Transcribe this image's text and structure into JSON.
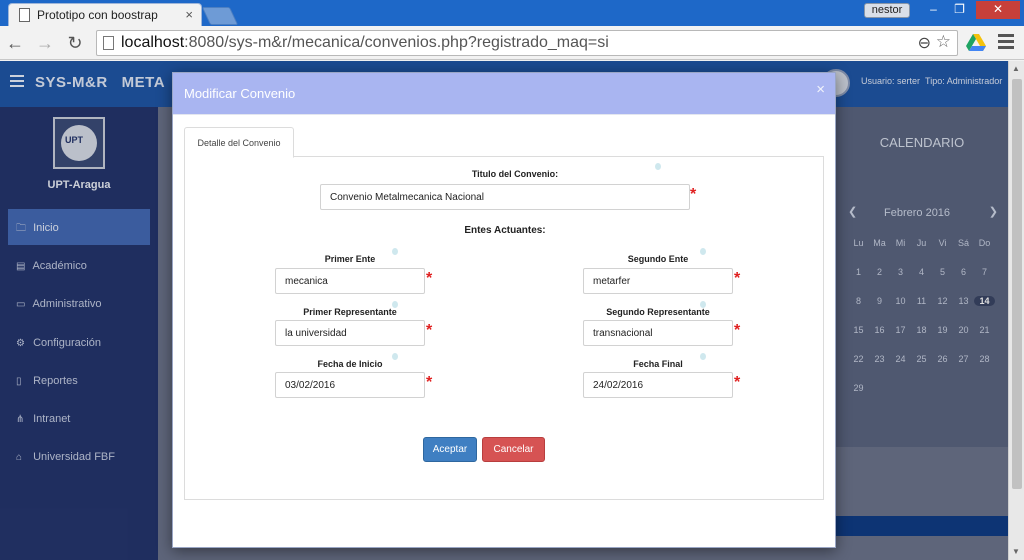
{
  "browser": {
    "tab_title": "Prototipo con boostrap",
    "tab_close": "×",
    "user_badge": "nestor",
    "url_host": "localhost",
    "url_path": ":8080/sys-m&r/mecanica/convenios.php?registrado_maq=si"
  },
  "app": {
    "brand": "SYS-M&R   META",
    "user_label": "Usuario: serter",
    "type_label": "Tipo: Administrador",
    "campus": "UPT-Aragua",
    "logo_text": "UPT"
  },
  "sidebar": {
    "items": [
      {
        "label": "Inicio",
        "icon": "folder-icon"
      },
      {
        "label": "Académico",
        "icon": "book-icon"
      },
      {
        "label": "Administrativo",
        "icon": "monitor-icon"
      },
      {
        "label": "Configuración",
        "icon": "cogs-icon"
      },
      {
        "label": "Reportes",
        "icon": "file-icon"
      },
      {
        "label": "Intranet",
        "icon": "sitemap-icon"
      },
      {
        "label": "Universidad FBF",
        "icon": "bank-icon"
      }
    ]
  },
  "calendar": {
    "title": "CALENDARIO",
    "month": "Febrero 2016",
    "weekdays": [
      "Lu",
      "Ma",
      "Mi",
      "Ju",
      "Vi",
      "Sá",
      "Do"
    ],
    "weeks": [
      [
        "1",
        "2",
        "3",
        "4",
        "5",
        "6",
        "7"
      ],
      [
        "8",
        "9",
        "10",
        "11",
        "12",
        "13",
        "14"
      ],
      [
        "15",
        "16",
        "17",
        "18",
        "19",
        "20",
        "21"
      ],
      [
        "22",
        "23",
        "24",
        "25",
        "26",
        "27",
        "28"
      ],
      [
        "29",
        "",
        "",
        "",
        "",
        "",
        ""
      ]
    ],
    "today": "14"
  },
  "modal": {
    "title": "Modificar Convenio",
    "close": "×",
    "tab_label": "Detalle del Convenio",
    "titulo_label": "Titulo del Convenio:",
    "titulo_value": "Convenio Metalmecanica Nacional",
    "entes_heading": "Entes Actuantes:",
    "primer_ente_label": "Primer Ente",
    "primer_ente_value": "mecanica",
    "segundo_ente_label": "Segundo Ente",
    "segundo_ente_value": "metarfer",
    "primer_rep_label": "Primer Representante",
    "primer_rep_value": "la universidad",
    "segundo_rep_label": "Segundo Representante",
    "segundo_rep_value": "transnacional",
    "fecha_inicio_label": "Fecha de Inicio",
    "fecha_inicio_value": "03/02/2016",
    "fecha_final_label": "Fecha Final",
    "fecha_final_value": "24/02/2016",
    "required_mark": "*",
    "accept_label": "Aceptar",
    "cancel_label": "Cancelar"
  },
  "colors": {
    "titlebar": "#1e68c8",
    "modal_header": "#a9b5f1",
    "accept": "#3f7fc2",
    "cancel": "#d65353",
    "required": "#e02020"
  }
}
